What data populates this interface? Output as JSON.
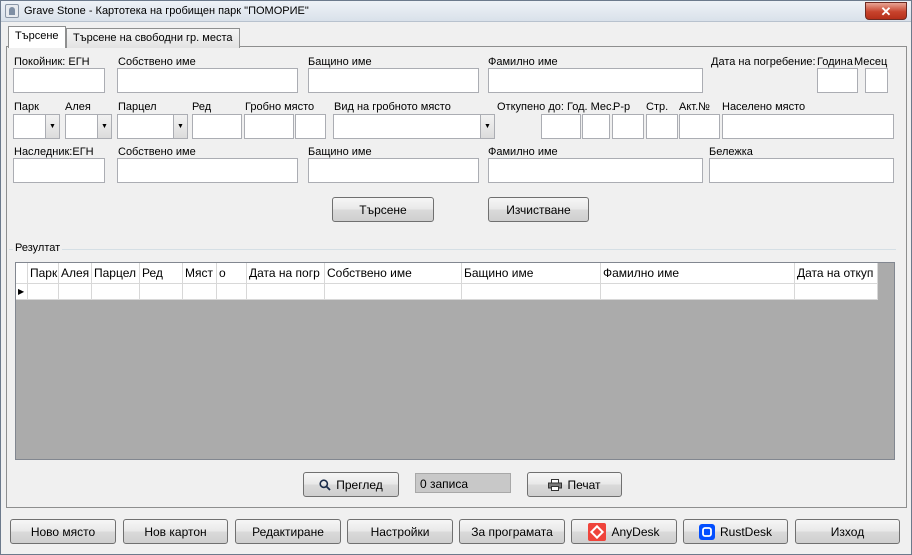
{
  "window": {
    "title": "Grave Stone - Картотека на гробищен парк \"ПОМОРИЕ\"",
    "close_glyph": "✕",
    "icon": "app-icon"
  },
  "tabs": [
    {
      "label": "Търсене",
      "active": true
    },
    {
      "label": "Търсене на свободни гр. места",
      "active": false
    }
  ],
  "deceased": {
    "egn_label": "Покойник: ЕГН",
    "first_name_label": "Собствено име",
    "middle_name_label": "Бащино име",
    "last_name_label": "Фамилно име",
    "burial_date_label": "Дата на погребение:",
    "year_label": "Година",
    "month_label": "Месец"
  },
  "location": {
    "park_label": "Парк",
    "alley_label": "Алея",
    "parcel_label": "Парцел",
    "row_label": "Ред",
    "plot_label": "Гробно място",
    "plot_type_label": "Вид на гробното място",
    "bought_until_label": "Откупено до: Год. Мес.",
    "rr_label": "Р-р",
    "page_label": "Стр.",
    "act_label": "Акт.№",
    "place_label": "Населено място"
  },
  "heir": {
    "egn_label": "Наследник:ЕГН",
    "first_name_label": "Собствено име",
    "middle_name_label": "Бащино име",
    "last_name_label": "Фамилно име",
    "note_label": "Бележка"
  },
  "actions": {
    "search_label": "Търсене",
    "clear_label": "Изчистване"
  },
  "results": {
    "title": "Резултат",
    "columns": [
      "Парк",
      "Алея",
      "Парцел",
      "Ред",
      "Мяст",
      "о",
      "Дата на погр",
      "Собствено име",
      "Бащино име",
      "Фамилно име",
      "Дата на откуп"
    ],
    "row_marker": "▶",
    "preview_label": "Преглед",
    "count_text": "0 записа",
    "print_label": "Печат"
  },
  "footer": {
    "new_place": "Ново място",
    "new_card": "Нов картон",
    "edit": "Редактиране",
    "settings": "Настройки",
    "about": "За програмата",
    "anydesk": "AnyDesk",
    "rustdesk": "RustDesk",
    "exit": "Изход"
  },
  "colors": {
    "close_button": "#c7432c",
    "anydesk": "#ef443b",
    "rustdesk": "#024eff"
  }
}
